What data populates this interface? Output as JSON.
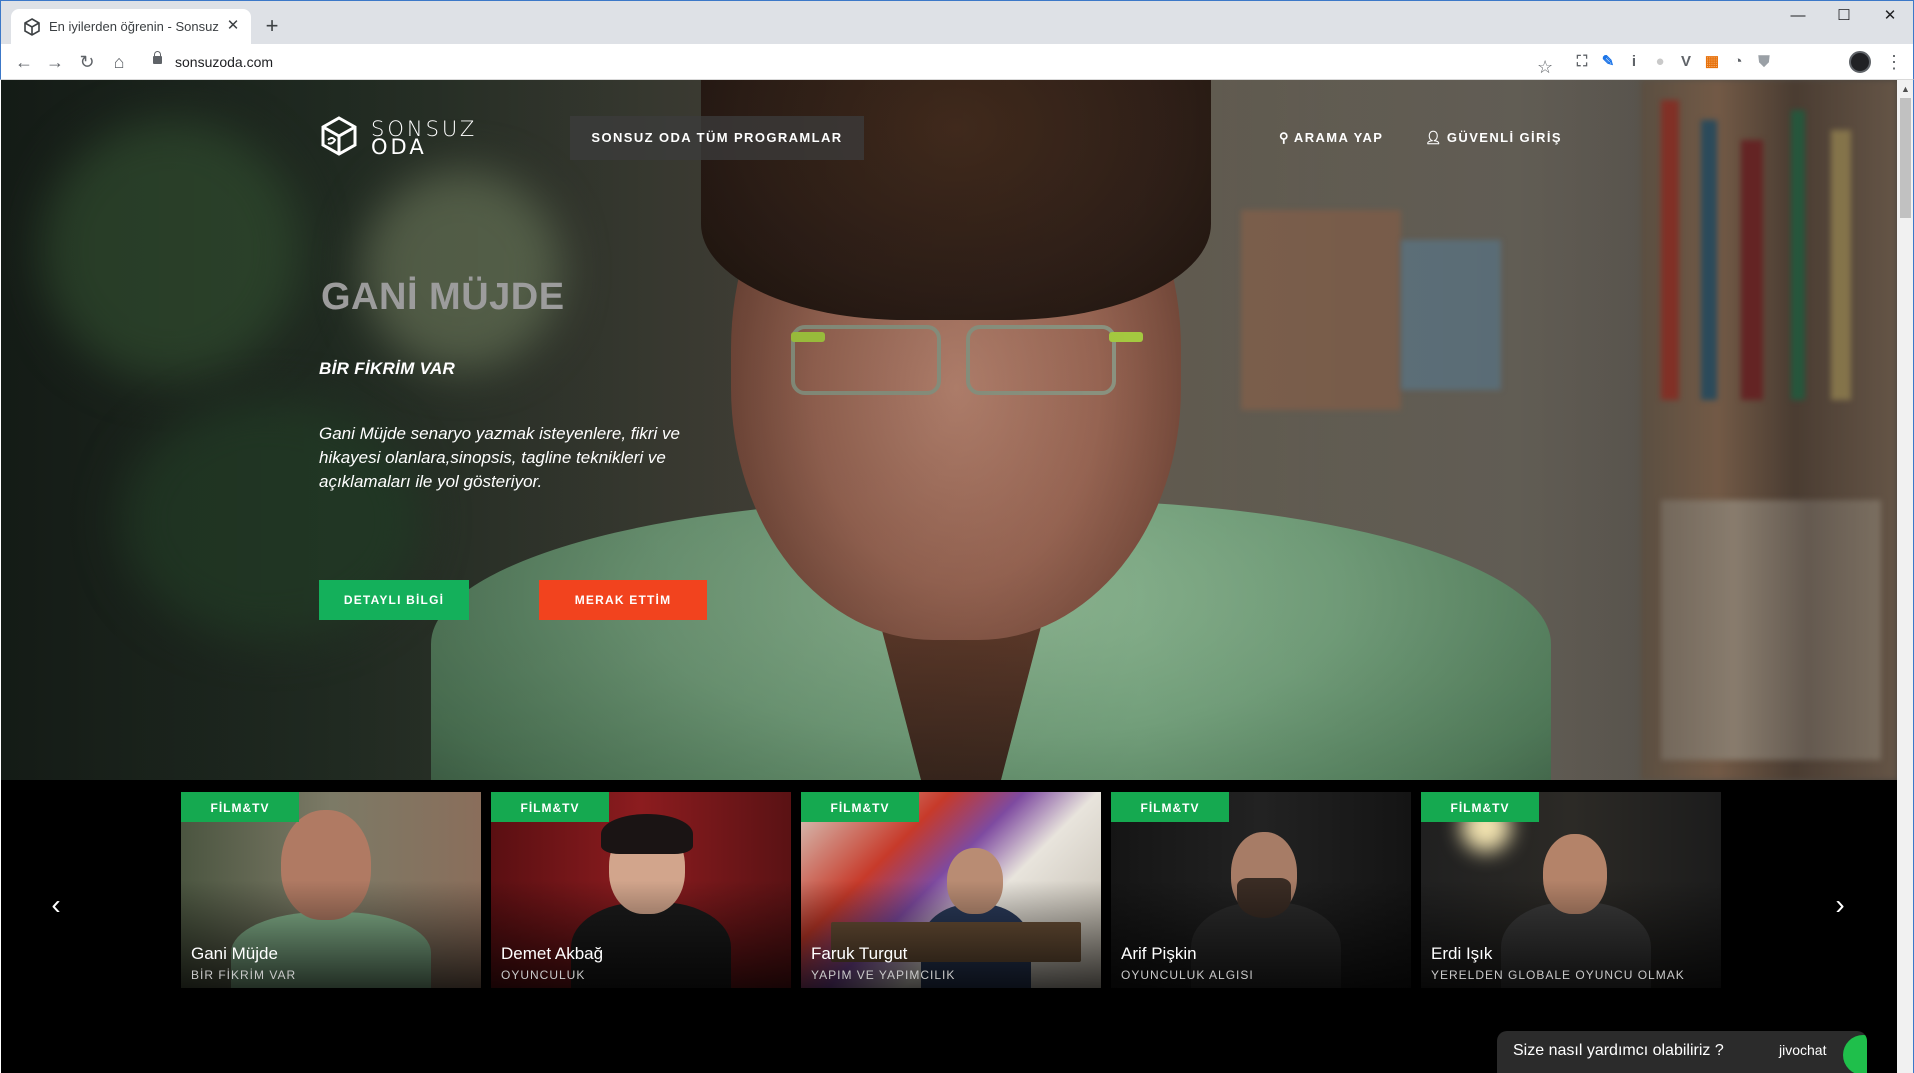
{
  "browser": {
    "tab_title": "En iyilerden öğrenin - Sonsuz Oda",
    "tab_close": "✕",
    "new_tab": "+",
    "url": "sonsuzoda.com",
    "window_controls": {
      "minimize": "—",
      "maximize": "☐",
      "close": "✕"
    },
    "nav": {
      "back": "←",
      "forward": "→",
      "reload": "↻",
      "home": "⌂"
    },
    "bookmark_star": "☆",
    "menu": "⋮",
    "extensions": [
      {
        "name": "capture-icon",
        "glyph": "⛶",
        "color": "#5f6368"
      },
      {
        "name": "pen-icon",
        "glyph": "✎",
        "color": "#1a73e8"
      },
      {
        "name": "info-icon",
        "glyph": "i",
        "color": "#5f6368"
      },
      {
        "name": "circle-icon",
        "glyph": "●",
        "color": "#c9c9c9"
      },
      {
        "name": "v-icon",
        "glyph": "V",
        "color": "#5f6368"
      },
      {
        "name": "calendar-icon",
        "glyph": "▦",
        "color": "#e8710a"
      },
      {
        "name": "timer-icon",
        "glyph": "◔",
        "color": "#5f6368"
      },
      {
        "name": "shield-icon",
        "glyph": "⛊",
        "color": "#9aa0a6"
      }
    ]
  },
  "header": {
    "logo_line1": "SONSUZ",
    "logo_line2": "ODA",
    "programs_label": "SONSUZ ODA TÜM PROGRAMLAR",
    "search_label": "ARAMA YAP",
    "login_label": "GÜVENLİ GİRİŞ"
  },
  "hero": {
    "title": "GANİ MÜJDE",
    "subtitle": "BİR FİKRİM VAR",
    "description": "Gani Müjde senaryo yazmak isteyenlere, fikri ve hikayesi olanlara,sinopsis, tagline teknikleri ve açıklamaları ile yol gösteriyor.",
    "detail_button": "DETAYLI BİLGİ",
    "curious_button": "MERAK ETTİM"
  },
  "carousel": {
    "prev": "‹",
    "next": "›",
    "cards": [
      {
        "badge": "FİLM&TV",
        "person": "Gani Müjde",
        "topic": "BİR FİKRİM VAR"
      },
      {
        "badge": "FİLM&TV",
        "person": "Demet Akbağ",
        "topic": "OYUNCULUK"
      },
      {
        "badge": "FİLM&TV",
        "person": "Faruk Turgut",
        "topic": "YAPIM VE YAPIMCILIK"
      },
      {
        "badge": "FİLM&TV",
        "person": "Arif Pişkin",
        "topic": "OYUNCULUK ALGISI"
      },
      {
        "badge": "FİLM&TV",
        "person": "Erdi Işık",
        "topic": "YERELDEN GLOBALE OYUNCU OLMAK"
      }
    ]
  },
  "chat": {
    "prompt": "Size nasıl yardımcı olabiliriz ?",
    "brand": "jivochat"
  },
  "colors": {
    "accent_green": "#14b05b",
    "accent_orange": "#f2431e",
    "badge_green": "#15a950"
  }
}
